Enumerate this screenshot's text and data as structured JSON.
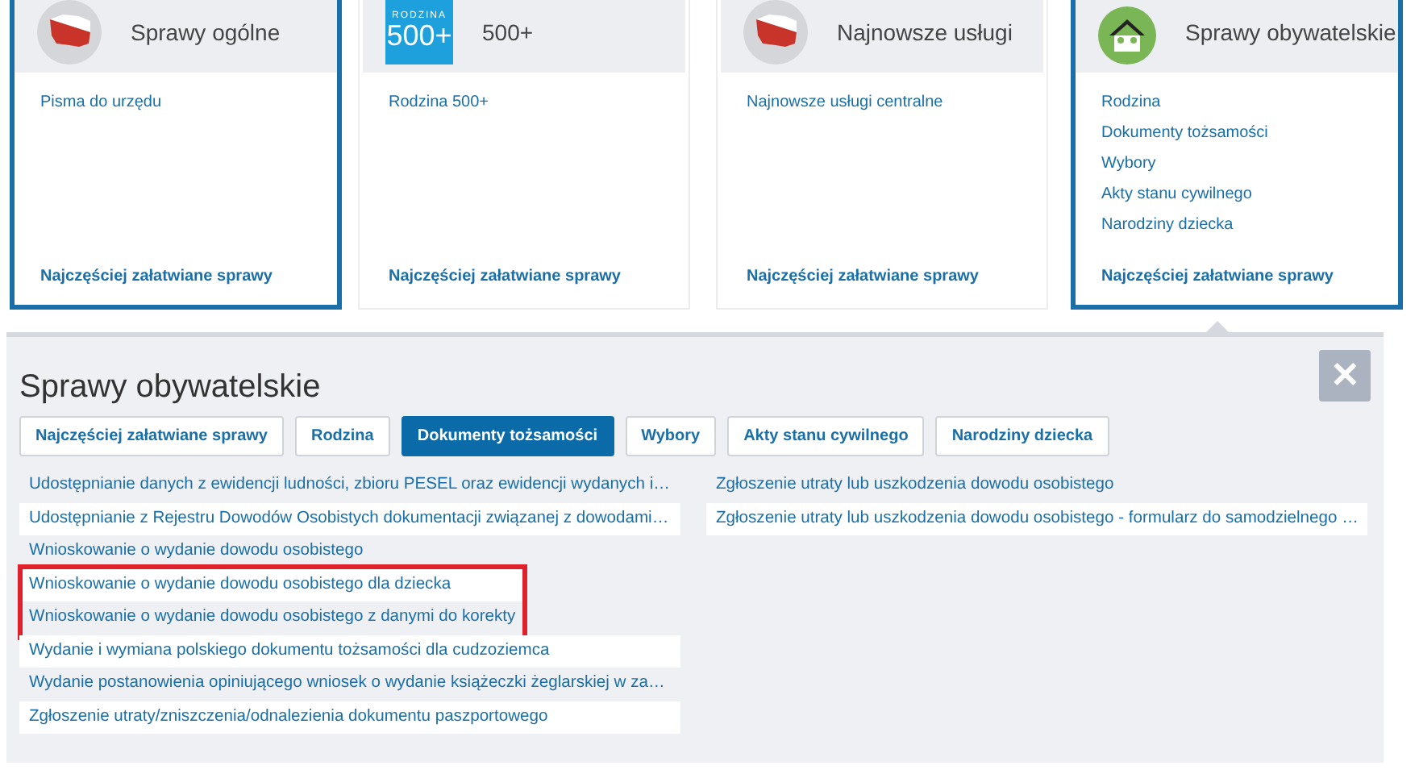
{
  "categories": [
    {
      "kind": "poland",
      "title": "Sprawy ogólne",
      "selected": true,
      "links": [
        "Pisma do urzędu"
      ],
      "footer": "Najczęściej załatwiane sprawy"
    },
    {
      "kind": "rodzina500",
      "title": "500+",
      "selected": false,
      "badge_top": "RODZINA",
      "badge_main": "500+",
      "links": [
        "Rodzina 500+"
      ],
      "footer": "Najczęściej załatwiane sprawy"
    },
    {
      "kind": "poland",
      "title": "Najnowsze usługi",
      "selected": false,
      "links": [
        "Najnowsze usługi centralne"
      ],
      "footer": "Najczęściej załatwiane sprawy"
    },
    {
      "kind": "house",
      "title": "Sprawy obywatelskie",
      "selected": true,
      "links": [
        "Rodzina",
        "Dokumenty tożsamości",
        "Wybory",
        "Akty stanu cywilnego",
        "Narodziny dziecka"
      ],
      "footer": "Najczęściej załatwiane sprawy"
    }
  ],
  "panel": {
    "title": "Sprawy obywatelskie",
    "close": "✕",
    "tabs": [
      {
        "label": "Najczęściej załatwiane sprawy",
        "selected": false
      },
      {
        "label": "Rodzina",
        "selected": false
      },
      {
        "label": "Dokumenty tożsamości",
        "selected": true
      },
      {
        "label": "Wybory",
        "selected": false
      },
      {
        "label": "Akty stanu cywilnego",
        "selected": false
      },
      {
        "label": "Narodziny dziecka",
        "selected": false
      }
    ],
    "columns": [
      [
        {
          "text": "Udostępnianie danych z ewidencji ludności, zbioru PESEL oraz ewidencji wydanych i…",
          "highlighted": false
        },
        {
          "text": "Udostępnianie z Rejestru Dowodów Osobistych dokumentacji związanej z dowodami…",
          "highlighted": false
        },
        {
          "text": "Wnioskowanie o wydanie dowodu osobistego",
          "highlighted": false
        },
        {
          "text": "Wnioskowanie o wydanie dowodu osobistego dla dziecka",
          "highlighted": true
        },
        {
          "text": "Wnioskowanie o wydanie dowodu osobistego z danymi do korekty",
          "highlighted": true
        },
        {
          "text": "Wydanie i wymiana polskiego dokumentu tożsamości dla cudzoziemca",
          "highlighted": false
        },
        {
          "text": "Wydanie postanowienia opiniującego wniosek o wydanie książeczki żeglarskiej w za…",
          "highlighted": false
        },
        {
          "text": "Zgłoszenie utraty/zniszczenia/odnalezienia dokumentu paszportowego",
          "highlighted": false
        }
      ],
      [
        {
          "text": "Zgłoszenie utraty lub uszkodzenia dowodu osobistego",
          "highlighted": false
        },
        {
          "text": "Zgłoszenie utraty lub uszkodzenia dowodu osobistego - formularz do samodzielnego …",
          "highlighted": false
        }
      ]
    ]
  }
}
